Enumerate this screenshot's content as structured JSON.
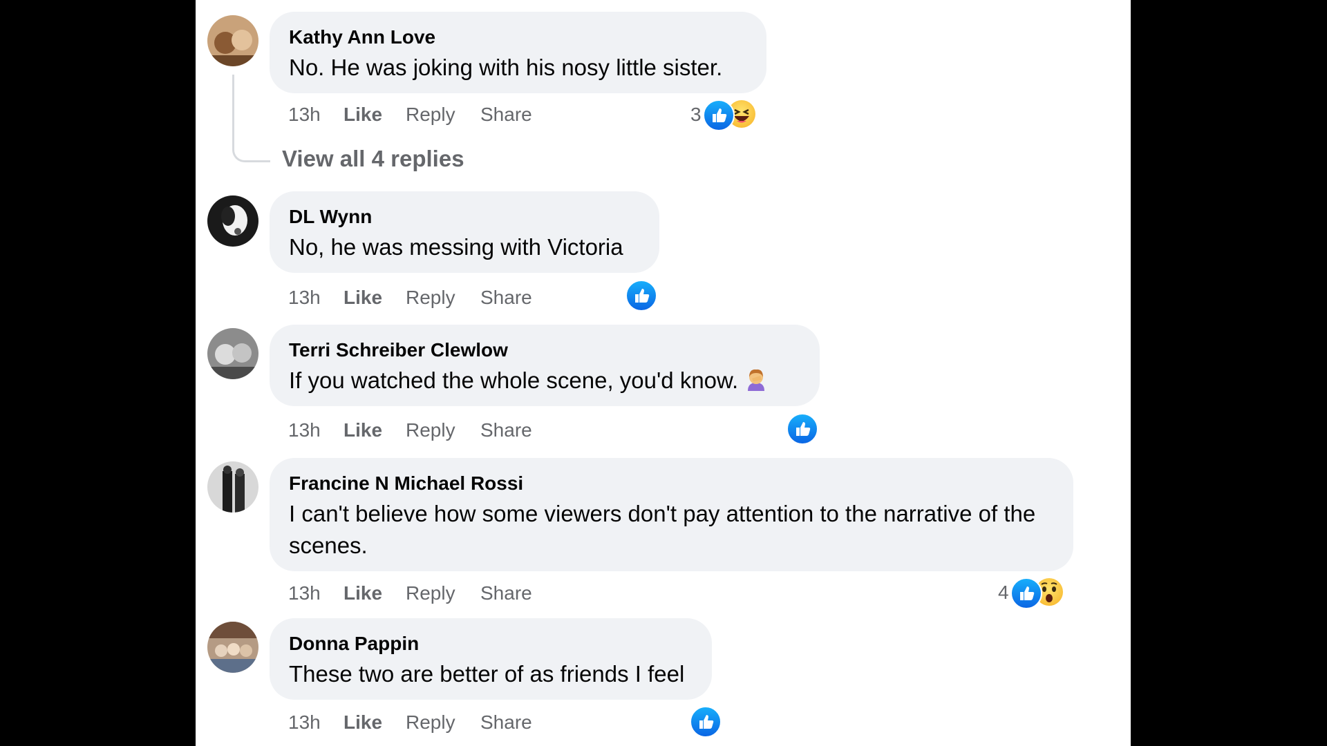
{
  "comments": [
    {
      "author": "Kathy Ann Love",
      "text": "No. He was joking with his nosy little sister.",
      "time": "13h",
      "like": "Like",
      "reply": "Reply",
      "share": "Share",
      "reaction_count": "3",
      "reactions": [
        "like-icon",
        "haha-icon"
      ],
      "view_replies": "View all 4 replies"
    },
    {
      "author": "DL Wynn",
      "text": "No, he was messing with Victoria",
      "time": "13h",
      "like": "Like",
      "reply": "Reply",
      "share": "Share",
      "reactions": [
        "like-icon"
      ]
    },
    {
      "author": "Terri Schreiber Clewlow",
      "text": "If you watched the whole scene, you'd know.",
      "emoji": "woman-facepalming-icon",
      "time": "13h",
      "like": "Like",
      "reply": "Reply",
      "share": "Share",
      "reactions": [
        "like-icon"
      ]
    },
    {
      "author": "Francine N Michael Rossi",
      "text": "I can't believe how some viewers don't pay attention to the narrative of the scenes.",
      "time": "13h",
      "like": "Like",
      "reply": "Reply",
      "share": "Share",
      "reaction_count": "4",
      "reactions": [
        "like-icon",
        "wow-icon"
      ]
    },
    {
      "author": "Donna Pappin",
      "text": "These two are better of as friends I feel",
      "time": "13h",
      "like": "Like",
      "reply": "Reply",
      "share": "Share",
      "reactions": [
        "like-icon"
      ]
    }
  ],
  "colors": {
    "bubble": "#f0f2f5",
    "secondary_text": "#65676b",
    "like_blue": "#0a66e4",
    "backdrop": "#000000"
  }
}
